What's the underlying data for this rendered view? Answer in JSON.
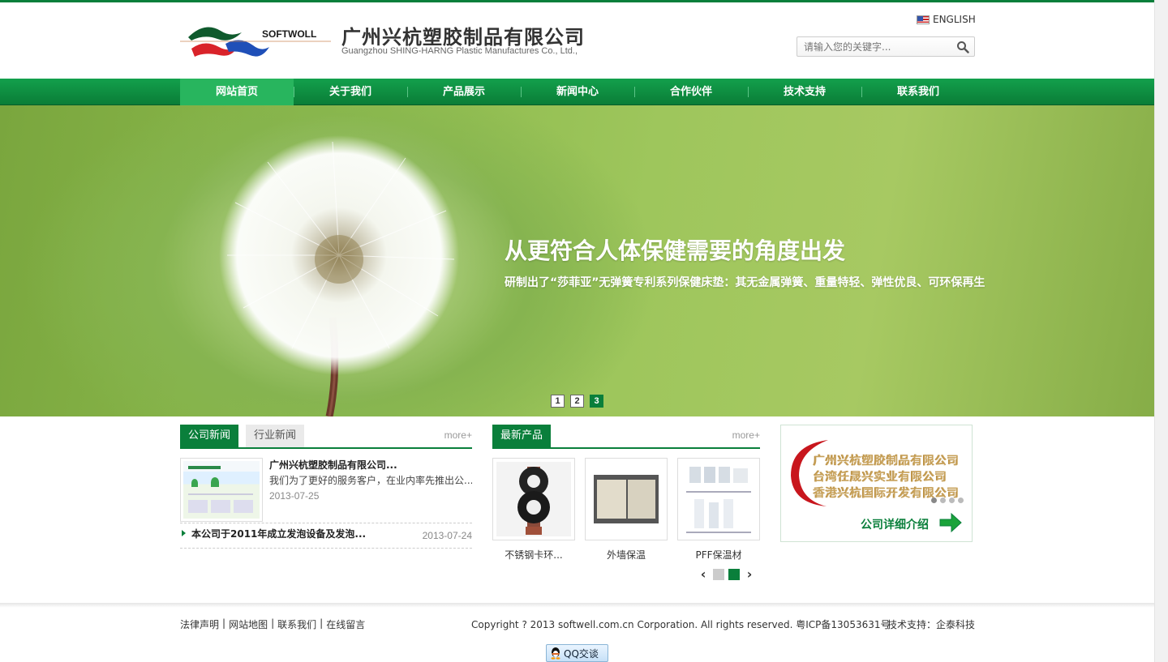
{
  "header": {
    "logo_text": "SOFTWOLL",
    "company_cn": "广州兴杭塑胶制品有限公司",
    "company_en": "Guangzhou SHING-HARNG Plastic Manufactures Co., Ltd.,",
    "language_link": "ENGLISH",
    "search_placeholder": "请输入您的关键字..."
  },
  "nav": {
    "items": [
      {
        "label": "网站首页",
        "active": true
      },
      {
        "label": "关于我们"
      },
      {
        "label": "产品展示"
      },
      {
        "label": "新闻中心"
      },
      {
        "label": "合作伙伴"
      },
      {
        "label": "技术支持"
      },
      {
        "label": "联系我们"
      }
    ]
  },
  "banner": {
    "title": "从更符合人体保健需要的角度出发",
    "subtitle": "研制出了“莎菲亚”无弹簧专利系列保健床垫：其无金属弹簧、重量特轻、弹性优良、可环保再生",
    "slides": [
      "1",
      "2",
      "3"
    ],
    "active_slide": "3"
  },
  "news": {
    "tab_active": "公司新闻",
    "tab_inactive": "行业新闻",
    "more": "more+",
    "featured": {
      "title": "广州兴杭塑胶制品有限公司...",
      "desc": "我们为了更好的服务客户，在业内率先推出公...",
      "date": "2013-07-25"
    },
    "items": [
      {
        "title": "本公司于2011年成立发泡设备及发泡...",
        "date": "2013-07-24"
      }
    ]
  },
  "products": {
    "tab": "最新产品",
    "more": "more+",
    "items": [
      {
        "label": "不锈钢卡环..."
      },
      {
        "label": "外墙保温"
      },
      {
        "label": "PFF保温材"
      }
    ],
    "pager": [
      "1",
      "2"
    ],
    "pager_active": 2
  },
  "intro": {
    "line1": "广州兴杭塑胶制品有限公司",
    "line2": "台湾任晟兴实业有限公司",
    "line3": "香港兴杭国际开发有限公司",
    "cta": "公司详细介绍"
  },
  "footer": {
    "links": [
      "法律声明",
      "网站地图",
      "联系我们",
      "在线留言"
    ],
    "separator": "|",
    "copyright": "Copyright ? 2013 softwell.com.cn Corporation. All rights reserved. 粤ICP备13053631号",
    "support": "技术支持：企泰科技",
    "qq_button": "QQ交谈"
  },
  "colors": {
    "brand_green": "#0a7f3b",
    "nav_active": "#28b55e",
    "banner_green": "#8cba4c"
  }
}
